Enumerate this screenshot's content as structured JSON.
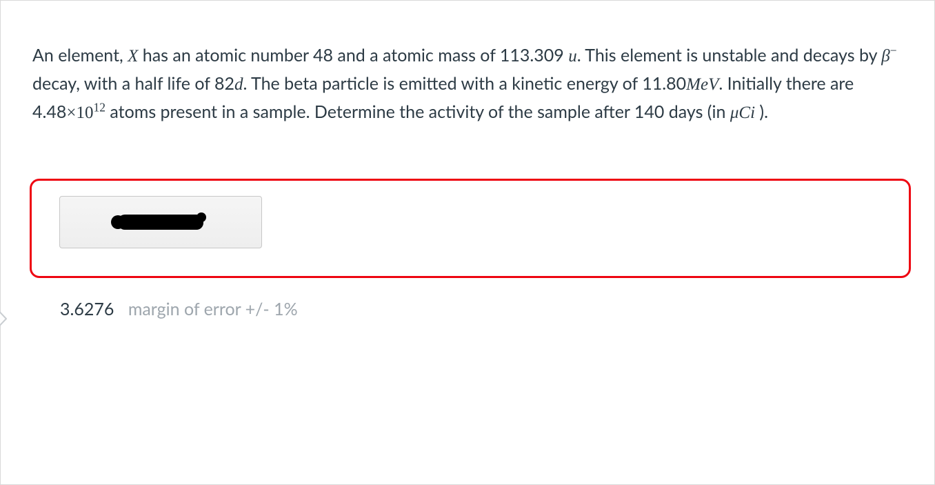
{
  "question": {
    "seg1": "An element,  ",
    "X": "X",
    "seg2": " has an   atomic number 48   and a atomic  mass of  113.309 ",
    "u": "u",
    "seg3": ". This element is unstable and decays by ",
    "beta": "β",
    "minus": "−",
    "seg4": "  decay, with a half life of 82",
    "d": "d",
    "seg5": ". The beta particle is emitted with a kinetic energy of 11.80",
    "MeV_M": "M",
    "MeV_e": "e",
    "MeV_V": "V",
    "seg6": ". Initially there are 4.48",
    "times": "×",
    "ten": "10",
    "exp": "12",
    "seg7": "  atoms present in a sample. Determine the  activity of the sample  after 140  days (in ",
    "mu": "μ",
    "C": "C",
    "i": "i",
    "seg8": " )."
  },
  "answer": {
    "value": "3.6276",
    "margin": "margin of error +/- 1%"
  }
}
